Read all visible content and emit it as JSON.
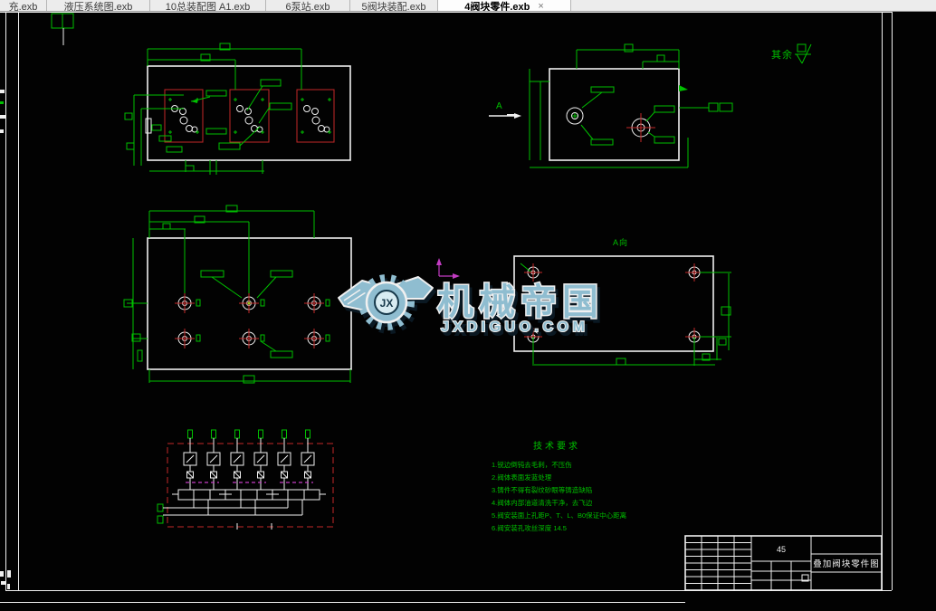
{
  "tabbar": {
    "tabs": [
      {
        "label": "充.exb",
        "active": false
      },
      {
        "label": "液压系统图.exb",
        "active": false
      },
      {
        "label": "10总装配图 A1.exb",
        "active": false
      },
      {
        "label": "6泵站.exb",
        "active": false
      },
      {
        "label": "5阀块装配.exb",
        "active": false
      },
      {
        "label": "4阀块零件.exb",
        "active": true
      }
    ],
    "close_label": "×"
  },
  "drawing": {
    "roughness_note": "其余",
    "view_a_title": "A向",
    "view_arrow_label": "A",
    "material": "45",
    "title_block_name": "叠加阀块零件图",
    "tech_requirements": {
      "title": "技术要求",
      "items": [
        "1.锐边倒钝去毛刺，不压伤",
        "2.阀体表面发蓝处理",
        "3.铸件不得有裂纹砂眼等铸造缺陷",
        "4.阀体内部油道清洗干净，去飞边",
        "5.阀安装面上孔距P、T、L、B0保证中心距离",
        "6.阀安装孔攻丝深度 14.5"
      ]
    },
    "watermark": {
      "badge": "JX",
      "title": "机械帝国",
      "url": "JXDIGUO.COM"
    }
  },
  "colors": {
    "green": "#00c000",
    "red": "#c42828",
    "magenta": "#c43cc4",
    "white": "#f0f0f0",
    "teal": "#8fbdd0",
    "teal_light": "#d8ecf2",
    "ink": "#16384a",
    "canvas": "#020202"
  }
}
